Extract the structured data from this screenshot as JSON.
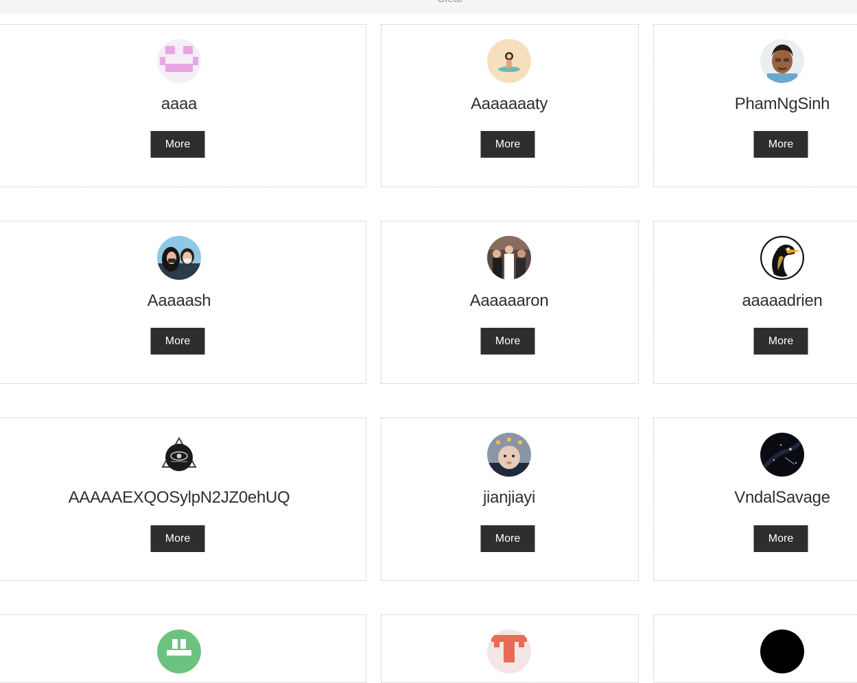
{
  "topbar": {
    "text": "Clear"
  },
  "cards": [
    {
      "username": "aaaa",
      "avatar": "pixel-face-avatar-icon",
      "button": "More"
    },
    {
      "username": "Aaaaaaaty",
      "avatar": "person-illustration-avatar-icon",
      "button": "More"
    },
    {
      "username": "PhamNgSinh",
      "avatar": "cartoon-man-avatar-icon",
      "button": "More"
    },
    {
      "username": "Aaaaash",
      "avatar": "couple-selfie-avatar-icon",
      "button": "More"
    },
    {
      "username": "Aaaaaaron",
      "avatar": "crowd-photo-avatar-icon",
      "button": "More"
    },
    {
      "username": "aaaaadrien",
      "avatar": "penguin-avatar-icon",
      "button": "More"
    },
    {
      "username": "AAAAAEXQOSylpN2JZ0ehUQ",
      "avatar": "eye-emblem-avatar-icon",
      "button": "More"
    },
    {
      "username": "jianjiayi",
      "avatar": "baby-photo-avatar-icon",
      "button": "More"
    },
    {
      "username": "VndalSavage",
      "avatar": "night-sky-avatar-icon",
      "button": "More"
    },
    {
      "username": "",
      "avatar": "green-pixel-avatar-icon",
      "button": ""
    },
    {
      "username": "",
      "avatar": "red-pixel-avatar-icon",
      "button": ""
    },
    {
      "username": "",
      "avatar": "black-circle-avatar-icon",
      "button": ""
    }
  ],
  "colors": {
    "button_bg": "#2e2e2e",
    "card_border": "#bdbdbd",
    "topbar_bg": "#f5f5f6"
  }
}
